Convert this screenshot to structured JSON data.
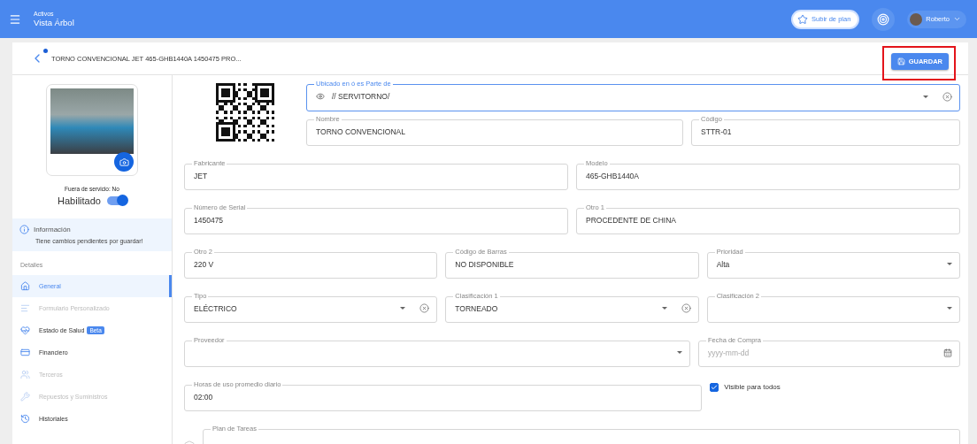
{
  "header": {
    "section": "Activos",
    "title": "Vista Árbol",
    "upgrade": "Subir de plan",
    "user": "Roberto"
  },
  "record": {
    "title": "TORNO CONVENCIONAL JET 465-GHB1440A 1450475 PRO...",
    "unsaved": true,
    "save": "GUARDAR",
    "save_highlighted": true
  },
  "sidebar": {
    "out_of_service": "Fuera de servicio: No",
    "enabled_label": "Habilitado",
    "enabled": true,
    "info": {
      "title": "Información",
      "text": "Tiene cambios pendientes por guardar!"
    },
    "section": "Detalles",
    "items": [
      {
        "label": "General",
        "selected": true,
        "disabled": false
      },
      {
        "label": "Formulario Personalizado",
        "selected": false,
        "disabled": true
      },
      {
        "label": "Estado de Salud",
        "selected": false,
        "disabled": false,
        "badge": "Beta"
      },
      {
        "label": "Financiero",
        "selected": false,
        "disabled": false
      },
      {
        "label": "Terceros",
        "selected": false,
        "disabled": true
      },
      {
        "label": "Repuestos y Suministros",
        "selected": false,
        "disabled": true
      },
      {
        "label": "Historiales",
        "selected": false,
        "disabled": false
      }
    ]
  },
  "form": {
    "top": [
      {
        "kind": "select",
        "label": "Ubicado en ó es Parte de",
        "value": "// SERVITORNO/",
        "clearable": true,
        "previewable": true,
        "focused": true
      },
      {
        "kind": "text",
        "label": "Nombre",
        "value": "TORNO CONVENCIONAL",
        "focused": false
      },
      {
        "kind": "text",
        "label": "Código",
        "value": "STTR-01",
        "focused": false
      }
    ],
    "rows": [
      {
        "kind": "half",
        "fields": [
          {
            "kind": "text",
            "label": "Fabricante",
            "value": "JET"
          },
          {
            "kind": "text",
            "label": "Modelo",
            "value": "465-GHB1440A"
          }
        ]
      },
      {
        "kind": "half",
        "fields": [
          {
            "kind": "text",
            "label": "Número de Serial",
            "value": "1450475"
          },
          {
            "kind": "text",
            "label": "Otro 1",
            "value": "PROCEDENTE DE CHINA"
          }
        ]
      },
      {
        "kind": "third",
        "fields": [
          {
            "kind": "text",
            "label": "Otro 2",
            "value": "220 V"
          },
          {
            "kind": "text",
            "label": "Código de Barras",
            "value": "NO DISPONIBLE"
          },
          {
            "kind": "select",
            "label": "Prioridad",
            "value": "Alta",
            "clearable": false
          }
        ]
      },
      {
        "kind": "third",
        "fields": [
          {
            "kind": "select",
            "label": "Tipo",
            "value": "ELÉCTRICO",
            "clearable": true
          },
          {
            "kind": "select",
            "label": "Clasificación 1",
            "value": "TORNEADO",
            "clearable": true
          },
          {
            "kind": "select",
            "label": "Clasificación 2",
            "clearable": false
          }
        ]
      },
      {
        "kind": "wide",
        "fields": [
          {
            "kind": "select",
            "label": "Proveedor",
            "clearable": false
          },
          {
            "kind": "date",
            "label": "Fecha de Compra",
            "placeholder": "yyyy-mm-dd"
          }
        ]
      },
      {
        "kind": "wide",
        "fields": [
          {
            "kind": "text",
            "label": "Horas de uso promedio diario",
            "value": "02:00"
          },
          {
            "kind": "checkbox",
            "label": "Visible para todos",
            "checked": true
          }
        ]
      },
      {
        "kind": "plan",
        "fields": [
          {
            "kind": "text",
            "label": "Plan de Tareas"
          }
        ]
      }
    ]
  }
}
